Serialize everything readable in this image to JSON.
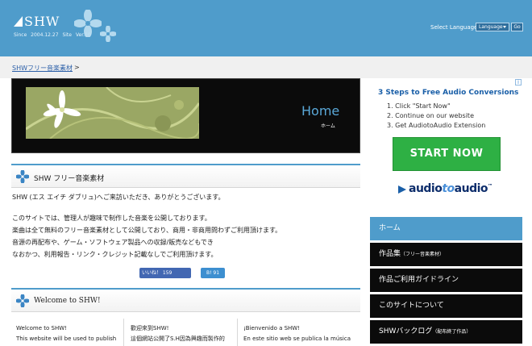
{
  "header": {
    "logo": "SHW",
    "since": "Since 2004.12.27",
    "version": "Site Ver.10",
    "language_label": "Select Language :",
    "language_value": "Language",
    "go_label": "Go"
  },
  "breadcrumb": {
    "link": "SHWフリー音楽素材",
    "sep": ">"
  },
  "hero": {
    "title": "Home",
    "subtitle": "ホーム"
  },
  "section1": {
    "title": "SHW フリー音楽素材",
    "lines": [
      "SHW (エス エイチ ダブリュ)へご来訪いただき、ありがとうございます。",
      "このサイトでは、管理人が趣味で制作した音楽を公開しております。",
      "楽曲は全て無料のフリー音楽素材として公開しており、商用・非商用問わずご利用頂けます。",
      "音源の再配布や、ゲーム・ソフトウェア製品への収録/販売などもでき",
      "なおかつ、利用報告・リンク・クレジット記載なしでご利用頂けます。"
    ],
    "like_label": "いいね！ 159",
    "hatena_label": "B! 91"
  },
  "section2": {
    "title": "Welcome to SHW!",
    "columns": [
      {
        "line1": "Welcome to SHW!",
        "line2": "This website will be used to publish"
      },
      {
        "line1": "歡迎來到SHW!",
        "line2": "這個網站公開了S.H因為興趣而製作的"
      },
      {
        "line1": "¡Bienvenido a SHW!",
        "line2": "En este sitio web se publica la música"
      }
    ]
  },
  "ad": {
    "title": "3 Steps to Free Audio Conversions",
    "steps": [
      "1. Click \"Start Now\"",
      "2. Continue on our website",
      "3. Get AudiotoAudio Extension"
    ],
    "button": "START NOW",
    "brand_a": "audio",
    "brand_to": "to",
    "brand_b": "audio",
    "tm": "™"
  },
  "nav": [
    {
      "label": "ホーム",
      "small": "",
      "active": true
    },
    {
      "label": "作品集",
      "small": "（フリー音楽素材）",
      "active": false
    },
    {
      "label": "作品ご利用ガイドライン",
      "small": "",
      "active": false
    },
    {
      "label": "このサイトについて",
      "small": "",
      "active": false
    },
    {
      "label": "SHWバックログ",
      "small": "（配布終了作品）",
      "active": false
    }
  ],
  "colors": {
    "accent": "#4f9ccb",
    "nav_bg": "#0b0b0b",
    "ad_button": "#2eb044"
  }
}
